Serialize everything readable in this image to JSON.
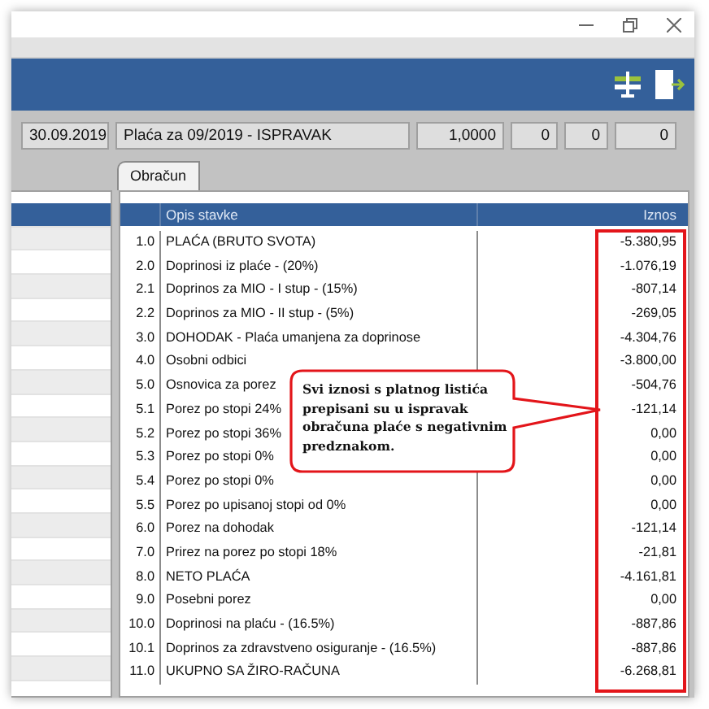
{
  "header_fields": [
    {
      "value": "30.09.2019",
      "kind": "text"
    },
    {
      "value": "Plaća za 09/2019 - ISPRAVAK",
      "kind": "text"
    },
    {
      "value": "1,0000",
      "kind": "number"
    },
    {
      "value": "0",
      "kind": "number"
    },
    {
      "value": "0",
      "kind": "number"
    },
    {
      "value": "0",
      "kind": "number"
    }
  ],
  "side_list": {
    "rows": [
      {
        "selected": true
      },
      {
        "selected": false
      },
      {
        "selected": false
      },
      {
        "selected": false
      },
      {
        "selected": false
      },
      {
        "selected": false
      },
      {
        "selected": false
      },
      {
        "selected": false
      },
      {
        "selected": false
      },
      {
        "selected": false
      },
      {
        "selected": false
      },
      {
        "selected": false
      },
      {
        "selected": false
      },
      {
        "selected": false
      },
      {
        "selected": false
      },
      {
        "selected": false
      },
      {
        "selected": false
      },
      {
        "selected": false
      },
      {
        "selected": false
      },
      {
        "selected": false
      }
    ]
  },
  "tabs": [
    {
      "label": "Obračun",
      "selected": true
    }
  ],
  "table": {
    "columns": [
      {
        "label": "Opis stavke"
      },
      {
        "label": "Iznos"
      }
    ],
    "rows": [
      {
        "code": "1.0",
        "description": "PLAĆA (BRUTO SVOTA)",
        "amount": "-5.380,95"
      },
      {
        "code": "2.0",
        "description": "Doprinosi iz plaće - (20%)",
        "amount": "-1.076,19"
      },
      {
        "code": "2.1",
        "description": "Doprinos za MIO - I stup - (15%)",
        "amount": "-807,14"
      },
      {
        "code": "2.2",
        "description": "Doprinos za MIO - II stup - (5%)",
        "amount": "-269,05"
      },
      {
        "code": "3.0",
        "description": "DOHODAK - Plaća umanjena za doprinose",
        "amount": "-4.304,76"
      },
      {
        "code": "4.0",
        "description": "Osobni odbici",
        "amount": "-3.800,00"
      },
      {
        "code": "5.0",
        "description": "Osnovica za porez",
        "amount": "-504,76"
      },
      {
        "code": "5.1",
        "description": "Porez po stopi 24%",
        "amount": "-121,14"
      },
      {
        "code": "5.2",
        "description": "Porez po stopi 36%",
        "amount": "0,00"
      },
      {
        "code": "5.3",
        "description": "Porez po stopi 0%",
        "amount": "0,00"
      },
      {
        "code": "5.4",
        "description": "Porez po stopi 0%",
        "amount": "0,00"
      },
      {
        "code": "5.5",
        "description": "Porez po upisanoj stopi od 0%",
        "amount": "0,00"
      },
      {
        "code": "6.0",
        "description": "Porez na dohodak",
        "amount": "-121,14"
      },
      {
        "code": "7.0",
        "description": "Prirez na porez po stopi 18%",
        "amount": "-21,81"
      },
      {
        "code": "8.0",
        "description": "NETO PLAĆA",
        "amount": "-4.161,81"
      },
      {
        "code": "9.0",
        "description": "Posebni porez",
        "amount": "0,00"
      },
      {
        "code": "10.0",
        "description": "Doprinosi na plaću - (16.5%)",
        "amount": "-887,86"
      },
      {
        "code": "10.1",
        "description": "Doprinos za zdravstveno osiguranje - (16.5%)",
        "amount": "-887,86"
      },
      {
        "code": "11.0",
        "description": "UKUPNO SA ŽIRO-RAČUNA",
        "amount": "-6.268,81"
      }
    ]
  },
  "callout": {
    "text": "Svi iznosi s platnog listića prepisani su u ispravak obračuna plaće s negativnim predznakom."
  }
}
